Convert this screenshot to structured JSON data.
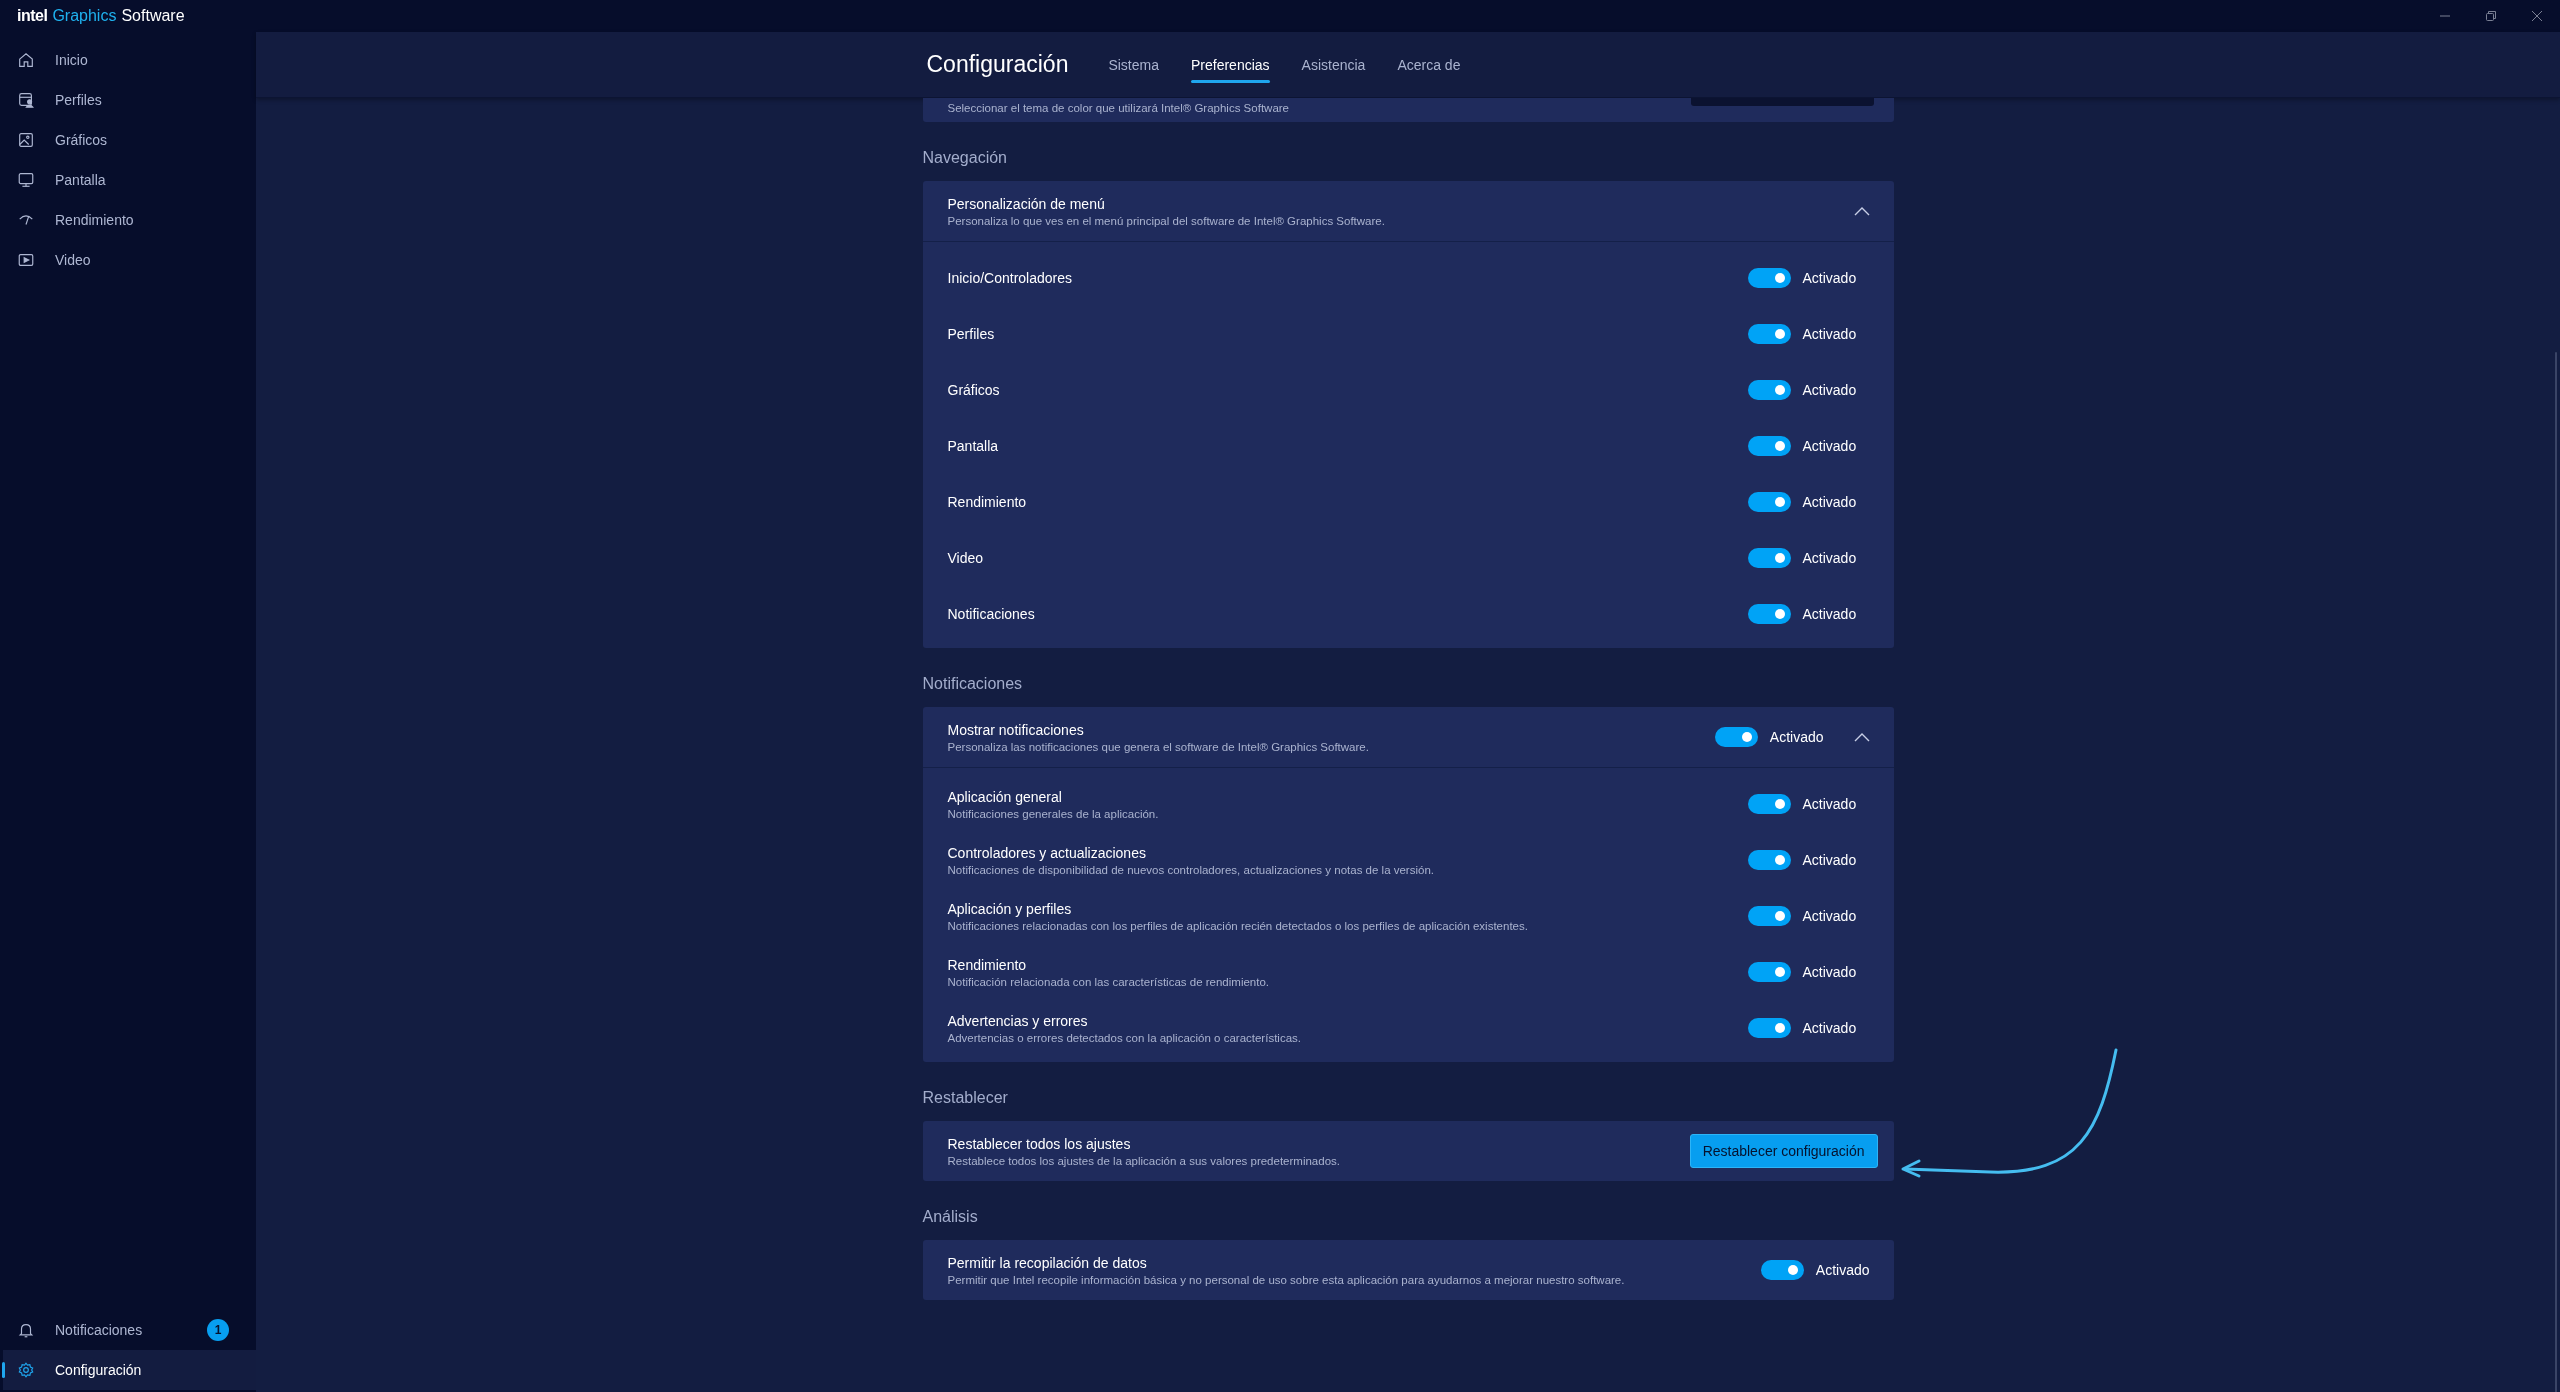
{
  "app_title": {
    "logo": "intel",
    "accent": "Graphics",
    "name": "Software"
  },
  "sidebar": {
    "items": [
      {
        "label": "Inicio",
        "selected": false
      },
      {
        "label": "Perfiles",
        "selected": false
      },
      {
        "label": "Gráficos",
        "selected": false
      },
      {
        "label": "Pantalla",
        "selected": false
      },
      {
        "label": "Rendimiento",
        "selected": false
      },
      {
        "label": "Video",
        "selected": false
      }
    ],
    "footer": [
      {
        "label": "Notificaciones",
        "badge": "1",
        "selected": false
      },
      {
        "label": "Configuración",
        "selected": true
      }
    ]
  },
  "header": {
    "title": "Configuración",
    "tabs": [
      {
        "label": "Sistema",
        "selected": false
      },
      {
        "label": "Preferencias",
        "selected": true
      },
      {
        "label": "Asistencia",
        "selected": false
      },
      {
        "label": "Acerca de",
        "selected": false
      }
    ]
  },
  "top_card": {
    "description": "Seleccionar el tema de color que utilizará Intel® Graphics Software"
  },
  "sections": [
    {
      "heading": "Navegación",
      "cards": [
        {
          "title": "Personalización de menú",
          "description": "Personaliza lo que ves en el menú principal del software de Intel® Graphics Software.",
          "expanded": true,
          "rows": [
            {
              "label": "Inicio/Controladores",
              "on": true,
              "state": "Activado"
            },
            {
              "label": "Perfiles",
              "on": true,
              "state": "Activado"
            },
            {
              "label": "Gráficos",
              "on": true,
              "state": "Activado"
            },
            {
              "label": "Pantalla",
              "on": true,
              "state": "Activado"
            },
            {
              "label": "Rendimiento",
              "on": true,
              "state": "Activado"
            },
            {
              "label": "Video",
              "on": true,
              "state": "Activado"
            },
            {
              "label": "Notificaciones",
              "on": true,
              "state": "Activado"
            }
          ]
        }
      ]
    },
    {
      "heading": "Notificaciones",
      "cards": [
        {
          "title": "Mostrar notificaciones",
          "description": "Personaliza las notificaciones que genera el software de Intel® Graphics Software.",
          "toggle": {
            "on": true,
            "state": "Activado"
          },
          "expanded": true,
          "rows": [
            {
              "label": "Aplicación general",
              "description": "Notificaciones generales de la aplicación.",
              "on": true,
              "state": "Activado"
            },
            {
              "label": "Controladores y actualizaciones",
              "description": "Notificaciones de disponibilidad de nuevos controladores, actualizaciones y notas de la versión.",
              "on": true,
              "state": "Activado"
            },
            {
              "label": "Aplicación y perfiles",
              "description": "Notificaciones relacionadas con los perfiles de aplicación recién detectados o los perfiles de aplicación existentes.",
              "on": true,
              "state": "Activado"
            },
            {
              "label": "Rendimiento",
              "description": "Notificación relacionada con las características de rendimiento.",
              "on": true,
              "state": "Activado"
            },
            {
              "label": "Advertencias y errores",
              "description": "Advertencias o errores detectados con la aplicación o características.",
              "on": true,
              "state": "Activado"
            }
          ]
        }
      ]
    },
    {
      "heading": "Restablecer",
      "cards": [
        {
          "title": "Restablecer todos los ajustes",
          "description": "Restablece todos los ajustes de la aplicación a sus valores predeterminados.",
          "button": "Restablecer configuración"
        }
      ]
    },
    {
      "heading": "Análisis",
      "cards": [
        {
          "title": "Permitir la recopilación de datos",
          "description": "Permitir que Intel recopile información básica y no personal de uso sobre esta aplicación para ayudarnos a mejorar nuestro software.",
          "toggle": {
            "on": true,
            "state": "Activado"
          }
        }
      ]
    }
  ]
}
